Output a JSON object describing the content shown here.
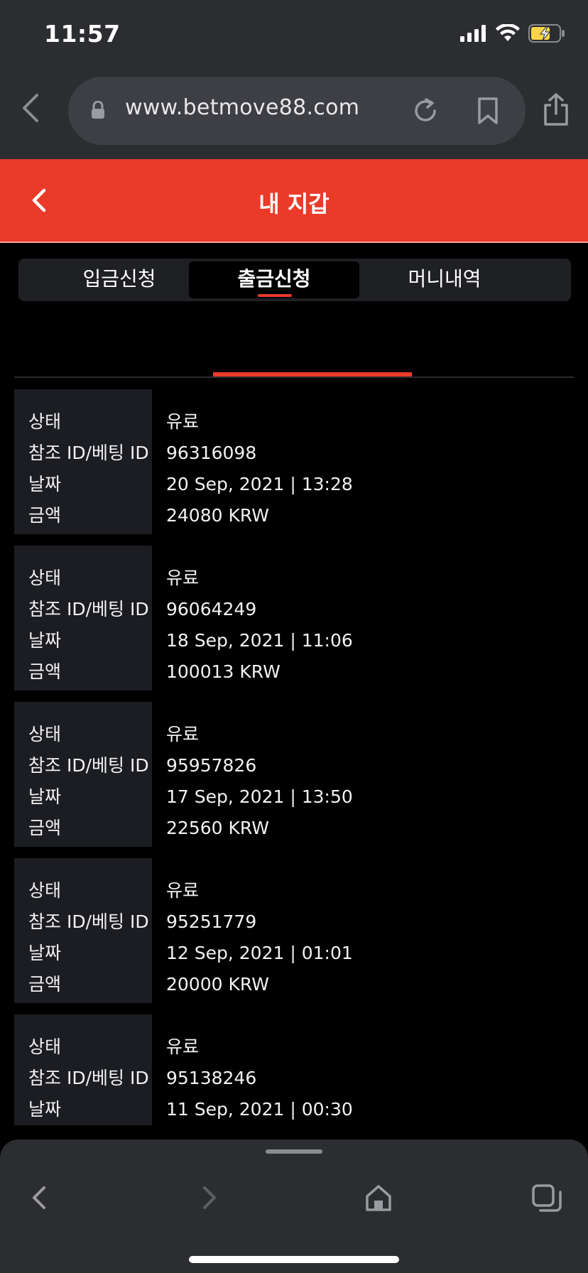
{
  "status_bar": {
    "time": "11:57",
    "icons": [
      "cellular-signal-icon",
      "wifi-icon",
      "battery-charging-icon"
    ]
  },
  "browser": {
    "url": "www.betmove88.com",
    "icons": [
      "back-chevron-icon",
      "lock-icon",
      "reload-icon",
      "bookmark-icon",
      "share-icon"
    ]
  },
  "header": {
    "title": "내 지갑",
    "accent_color": "#ea3a28"
  },
  "tabs": [
    {
      "label": "입금신청",
      "active": false
    },
    {
      "label": "출금신청",
      "active": true
    },
    {
      "label": "머니내역",
      "active": false
    }
  ],
  "records": [
    {
      "labels": [
        "상태",
        "참조 ID/베팅 ID",
        "날짜",
        "금액"
      ],
      "status": "유료",
      "ref_id": "96316098",
      "date": "20 Sep, 2021 | 13:28",
      "amount": "24080 KRW"
    },
    {
      "labels": [
        "상태",
        "참조 ID/베팅 ID",
        "날짜",
        "금액"
      ],
      "status": "유료",
      "ref_id": "96064249",
      "date": "18 Sep, 2021 | 11:06",
      "amount": "100013 KRW"
    },
    {
      "labels": [
        "상태",
        "참조 ID/베팅 ID",
        "날짜",
        "금액"
      ],
      "status": "유료",
      "ref_id": "95957826",
      "date": "17 Sep, 2021 | 13:50",
      "amount": "22560 KRW"
    },
    {
      "labels": [
        "상태",
        "참조 ID/베팅 ID",
        "날짜",
        "금액"
      ],
      "status": "유료",
      "ref_id": "95251779",
      "date": "12 Sep, 2021 | 01:01",
      "amount": "20000 KRW"
    },
    {
      "labels": [
        "상태",
        "참조 ID/베팅 ID",
        "날짜"
      ],
      "status": "유료",
      "ref_id": "95138246",
      "date": "11 Sep, 2021 | 00:30"
    }
  ],
  "toolbar_icons": [
    "back-icon",
    "forward-icon",
    "home-icon",
    "tabs-icon"
  ]
}
